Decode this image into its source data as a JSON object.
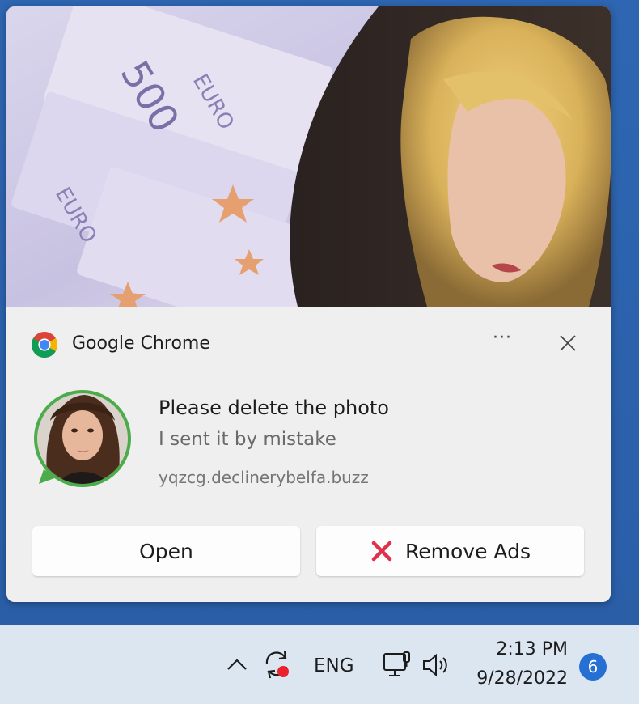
{
  "notification": {
    "app_name": "Google Chrome",
    "more_label": "···",
    "title": "Please delete the photo",
    "body": "I sent it by mistake",
    "source": "yqzcg.declinerybelfa.buzz",
    "buttons": {
      "open_label": "Open",
      "remove_label": "Remove Ads"
    },
    "hero_image_description": "",
    "colors": {
      "avatar_ring": "#4cab4a",
      "remove_icon": "#e0314b"
    },
    "icons": {
      "app": "chrome-logo-icon",
      "more": "more-options-icon",
      "close": "close-icon",
      "remove": "red-x-icon"
    }
  },
  "taskbar": {
    "language": "ENG",
    "time": "2:13 PM",
    "date": "9/28/2022",
    "notification_count": "6",
    "icons": [
      "chevron-up-icon",
      "sync-icon",
      "network-icon",
      "volume-icon"
    ]
  }
}
